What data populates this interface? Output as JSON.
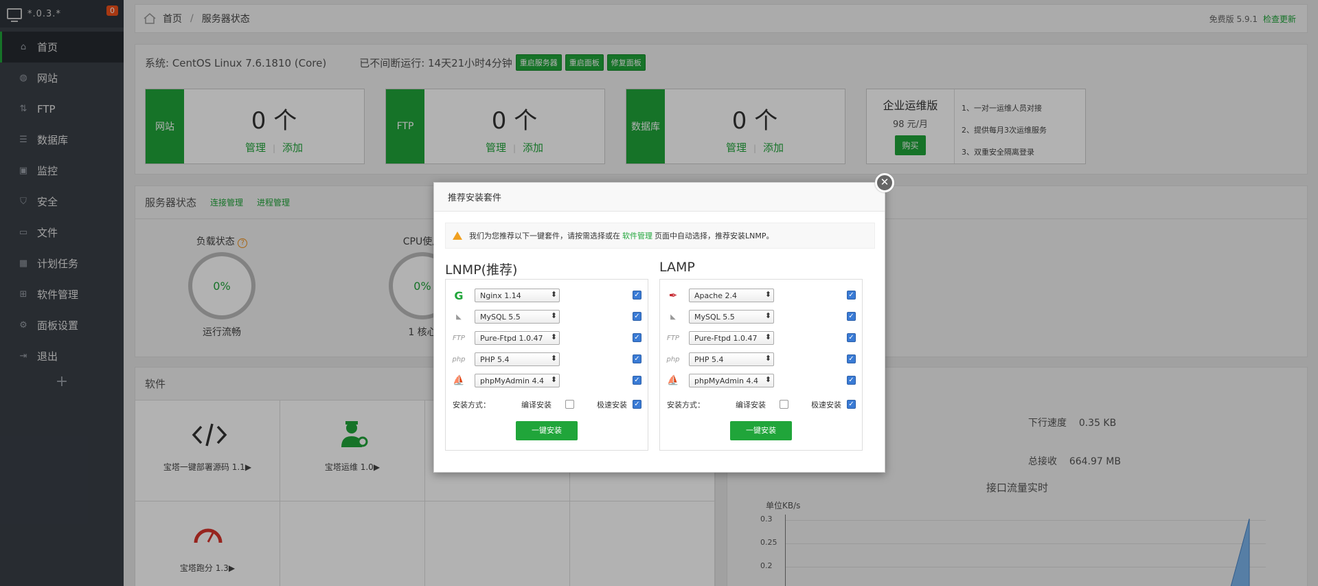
{
  "sidebar": {
    "ip": "*.0.3.*",
    "badge": "0",
    "items": [
      {
        "label": "首页",
        "icon": "home-icon"
      },
      {
        "label": "网站",
        "icon": "globe-icon"
      },
      {
        "label": "FTP",
        "icon": "ftp-icon"
      },
      {
        "label": "数据库",
        "icon": "database-icon"
      },
      {
        "label": "监控",
        "icon": "monitor-icon"
      },
      {
        "label": "安全",
        "icon": "shield-icon"
      },
      {
        "label": "文件",
        "icon": "folder-icon"
      },
      {
        "label": "计划任务",
        "icon": "calendar-icon"
      },
      {
        "label": "软件管理",
        "icon": "apps-icon"
      },
      {
        "label": "面板设置",
        "icon": "gear-icon"
      },
      {
        "label": "退出",
        "icon": "logout-icon"
      }
    ],
    "add": "+"
  },
  "topbar": {
    "crumb_home": "首页",
    "crumb_current": "服务器状态",
    "version": "免费版 5.9.1",
    "update": "检查更新"
  },
  "system": {
    "os": "系统: CentOS Linux 7.6.1810 (Core)",
    "uptime": "已不间断运行: 14天21小时4分钟",
    "btn_restart_server": "重启服务器",
    "btn_restart_panel": "重启面板",
    "btn_repair_panel": "修复面板"
  },
  "stats": [
    {
      "label": "网站",
      "count": "0 个",
      "manage": "管理",
      "add": "添加"
    },
    {
      "label": "FTP",
      "count": "0 个",
      "manage": "管理",
      "add": "添加"
    },
    {
      "label": "数据库",
      "count": "0 个",
      "manage": "管理",
      "add": "添加"
    }
  ],
  "enterprise": {
    "title": "企业运维版",
    "price": "98 元/月",
    "buy": "购买",
    "features": [
      "1、一对一运维人员对接",
      "2、提供每月3次运维服务",
      "3、双重安全隔离登录"
    ]
  },
  "server_status": {
    "title": "服务器状态",
    "link_conn": "连接管理",
    "link_proc": "进程管理",
    "load_label": "负载状态",
    "load_help": "?",
    "load_value": "0%",
    "load_sub": "运行流畅",
    "cpu_label": "CPU使用",
    "cpu_value": "0%",
    "cpu_sub": "1 核心"
  },
  "software": {
    "title": "软件",
    "items": [
      {
        "name": "宝塔一键部署源码 1.1▶",
        "icon": "code-icon"
      },
      {
        "name": "宝塔运维 1.0▶",
        "icon": "operator-icon"
      },
      {
        "name": "宝塔跑分 1.3▶",
        "icon": "speedometer-icon"
      }
    ]
  },
  "traffic": {
    "down_label": "下行速度",
    "down_value": "0.35 KB",
    "recv_label": "总接收",
    "recv_value": "664.97 MB",
    "chart_title": "接口流量实时",
    "unit": "单位KB/s",
    "yticks": [
      "0.3",
      "0.25",
      "0.2"
    ]
  },
  "dialog": {
    "title": "推荐安装套件",
    "close": "✕",
    "notice_before": "我们为您推荐以下一键套件，请按需选择或在",
    "notice_link": "软件管理",
    "notice_after": "页面中自动选择，推荐安装LNMP。",
    "mode_label": "安装方式：",
    "compile": "编译安装",
    "fast": "极速安装",
    "install_btn": "一键安装",
    "lnmp": {
      "title": "LNMP(推荐)",
      "rows": [
        {
          "icon": "nginx-icon",
          "glyph": "G",
          "value": "Nginx 1.14"
        },
        {
          "icon": "mysql-icon",
          "glyph": "◣",
          "value": "MySQL 5.5"
        },
        {
          "icon": "ftp-icon",
          "glyph": "FTP",
          "value": "Pure-Ftpd 1.0.47"
        },
        {
          "icon": "php-icon",
          "glyph": "php",
          "value": "PHP 5.4"
        },
        {
          "icon": "phpmyadmin-icon",
          "glyph": "⛵",
          "value": "phpMyAdmin 4.4"
        }
      ]
    },
    "lamp": {
      "title": "LAMP",
      "rows": [
        {
          "icon": "apache-icon",
          "glyph": "✒",
          "value": "Apache 2.4"
        },
        {
          "icon": "mysql-icon",
          "glyph": "◣",
          "value": "MySQL 5.5"
        },
        {
          "icon": "ftp-icon",
          "glyph": "FTP",
          "value": "Pure-Ftpd 1.0.47"
        },
        {
          "icon": "php-icon",
          "glyph": "php",
          "value": "PHP 5.4"
        },
        {
          "icon": "phpmyadmin-icon",
          "glyph": "⛵",
          "value": "phpMyAdmin 4.4"
        }
      ]
    }
  },
  "colors": {
    "accent": "#20a53a",
    "sidebar": "#3a3f47",
    "badge": "#f0511a"
  }
}
